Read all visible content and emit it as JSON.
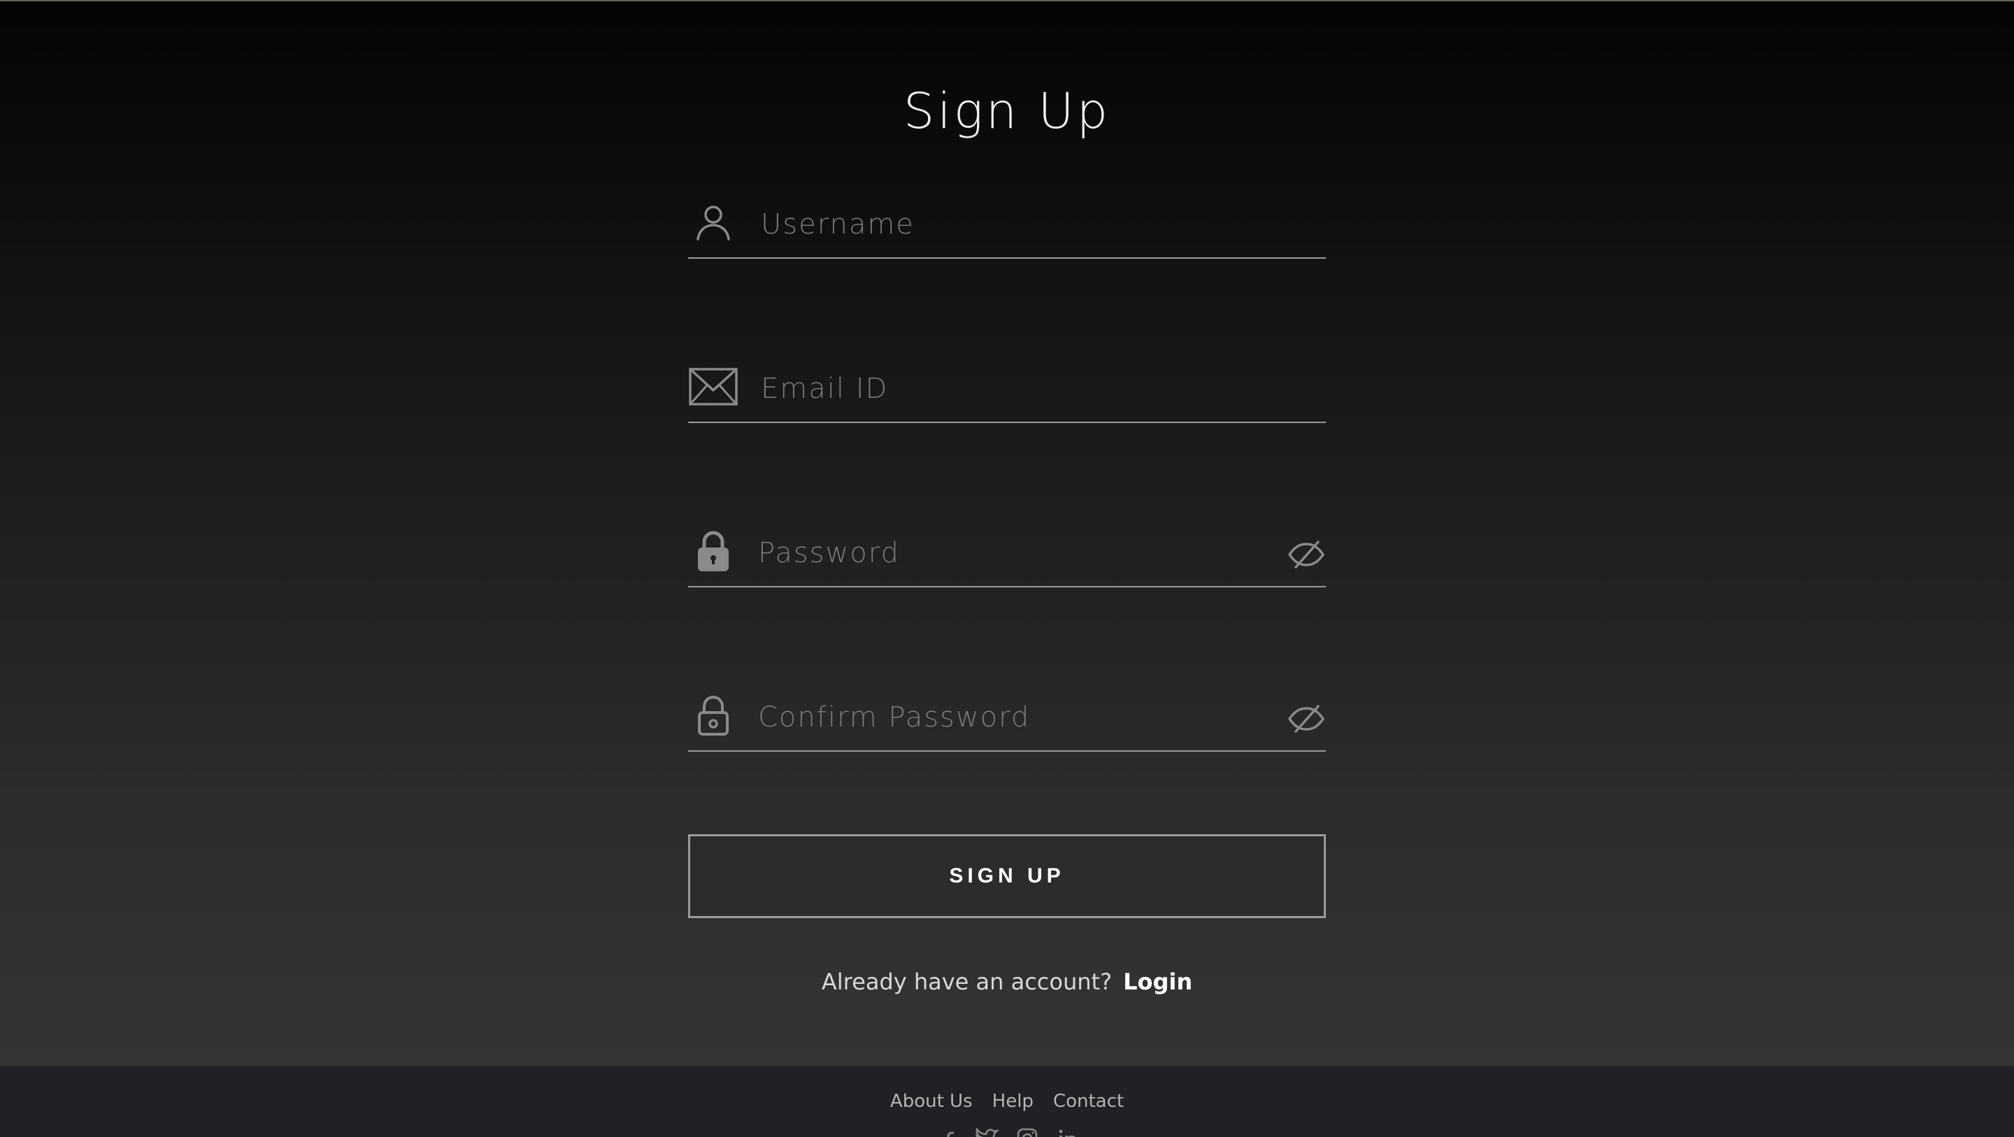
{
  "form": {
    "title": "Sign Up",
    "username": {
      "placeholder": "Username",
      "value": "",
      "icon": "user-icon"
    },
    "email": {
      "placeholder": "Email ID",
      "value": "",
      "icon": "envelope-icon"
    },
    "password": {
      "placeholder": "Password",
      "value": "",
      "icon": "lock-icon",
      "toggle_icon": "eye-slash-icon"
    },
    "confirm_password": {
      "placeholder": "Confirm Password",
      "value": "",
      "icon": "lock-outline-icon",
      "toggle_icon": "eye-slash-icon"
    },
    "submit_label": "SIGN UP",
    "login_prompt": "Already have an account?",
    "login_link": "Login"
  },
  "footer": {
    "links": [
      "About Us",
      "Help",
      "Contact"
    ],
    "socials": [
      "facebook-icon",
      "twitter-icon",
      "instagram-icon",
      "linkedin-icon"
    ]
  },
  "colors": {
    "accent": "#ffffff",
    "muted_text": "#7a7a7a",
    "underline": "#9a9a9a",
    "footer_bg": "#202125"
  }
}
